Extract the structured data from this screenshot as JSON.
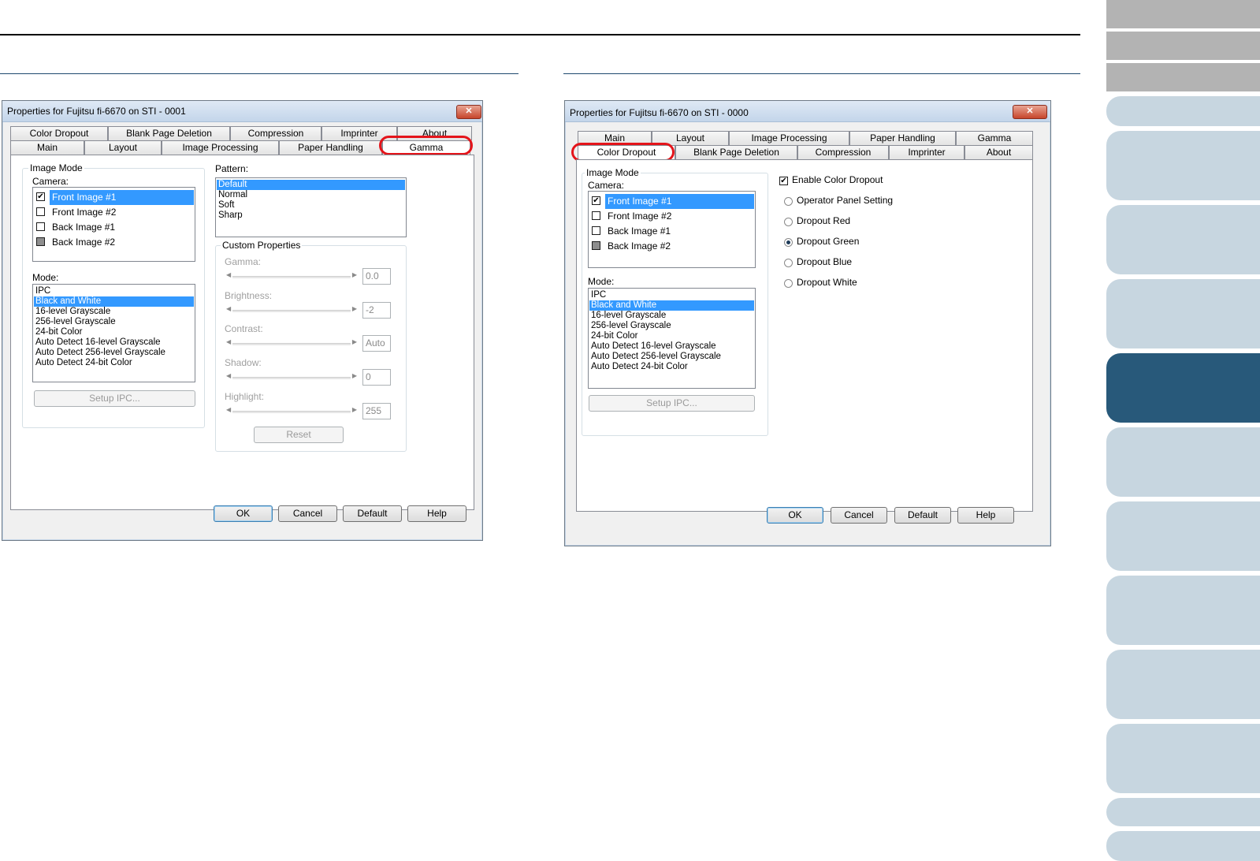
{
  "dialog_gamma": {
    "title": "Properties for Fujitsu fi-6670 on STI - 0001",
    "close_glyph": "✕",
    "tabs_back": [
      "Color Dropout",
      "Blank Page Deletion",
      "Compression",
      "Imprinter",
      "About"
    ],
    "tabs_front": [
      "Main",
      "Layout",
      "Image Processing",
      "Paper Handling",
      "Gamma"
    ],
    "selected_tab": "Gamma",
    "image_mode": {
      "group_label": "Image Mode",
      "camera_label": "Camera:",
      "cameras": [
        {
          "label": "Front Image #1",
          "checked": true,
          "selected": true
        },
        {
          "label": "Front Image #2",
          "checked": false,
          "selected": false
        },
        {
          "label": "Back Image #1",
          "checked": false,
          "selected": false
        },
        {
          "label": "Back Image #2",
          "checked": false,
          "greyed": true,
          "selected": false
        }
      ],
      "mode_label": "Mode:",
      "modes": [
        "IPC",
        "Black and White",
        "16-level Grayscale",
        "256-level Grayscale",
        "24-bit Color",
        "Auto Detect 16-level Grayscale",
        "Auto Detect 256-level Grayscale",
        "Auto Detect 24-bit Color"
      ],
      "selected_mode": "Black and White",
      "setup_button": "Setup IPC..."
    },
    "pattern": {
      "label": "Pattern:",
      "items": [
        "Default",
        "Normal",
        "Soft",
        "Sharp"
      ],
      "selected": "Default"
    },
    "custom_properties": {
      "group_label": "Custom Properties",
      "gamma_label": "Gamma:",
      "gamma_value": "0.0",
      "brightness_label": "Brightness:",
      "brightness_value": "-2",
      "contrast_label": "Contrast:",
      "contrast_value": "Auto",
      "shadow_label": "Shadow:",
      "shadow_value": "0",
      "highlight_label": "Highlight:",
      "highlight_value": "255",
      "reset_button": "Reset"
    },
    "buttons": {
      "ok": "OK",
      "cancel": "Cancel",
      "default": "Default",
      "help": "Help"
    }
  },
  "dialog_dropout": {
    "title": "Properties for Fujitsu fi-6670 on STI - 0000",
    "close_glyph": "✕",
    "tabs_back": [
      "Main",
      "Layout",
      "Image Processing",
      "Paper Handling",
      "Gamma"
    ],
    "tabs_front": [
      "Color Dropout",
      "Blank Page Deletion",
      "Compression",
      "Imprinter",
      "About"
    ],
    "selected_tab": "Color Dropout",
    "image_mode": {
      "group_label": "Image Mode",
      "camera_label": "Camera:",
      "cameras": [
        {
          "label": "Front Image #1",
          "checked": true,
          "selected": true
        },
        {
          "label": "Front Image #2",
          "checked": false,
          "selected": false
        },
        {
          "label": "Back Image #1",
          "checked": false,
          "selected": false
        },
        {
          "label": "Back Image #2",
          "checked": false,
          "greyed": true,
          "selected": false
        }
      ],
      "mode_label": "Mode:",
      "modes": [
        "IPC",
        "Black and White",
        "16-level Grayscale",
        "256-level Grayscale",
        "24-bit Color",
        "Auto Detect 16-level Grayscale",
        "Auto Detect 256-level Grayscale",
        "Auto Detect 24-bit Color"
      ],
      "selected_mode": "Black and White",
      "setup_button": "Setup IPC..."
    },
    "enable_dropout": {
      "label": "Enable Color Dropout",
      "checked": true
    },
    "dropout_options": [
      {
        "label": "Operator Panel Setting",
        "selected": false
      },
      {
        "label": "Dropout Red",
        "selected": false
      },
      {
        "label": "Dropout Green",
        "selected": true
      },
      {
        "label": "Dropout Blue",
        "selected": false
      },
      {
        "label": "Dropout White",
        "selected": false
      }
    ],
    "buttons": {
      "ok": "OK",
      "cancel": "Cancel",
      "default": "Default",
      "help": "Help"
    }
  },
  "check_glyph": "✔",
  "arrow_left": "◀",
  "arrow_right": "▶",
  "colors": {
    "highlight_oval": "#e4141a",
    "selection": "#3399ff",
    "nav_active": "#28597a",
    "nav_light": "#c7d6e0",
    "nav_gray": "#b3b3b3"
  }
}
